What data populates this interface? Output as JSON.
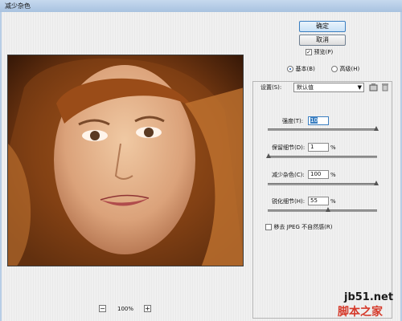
{
  "window": {
    "title": "减少杂色"
  },
  "buttons": {
    "ok": "确定",
    "cancel": "取消"
  },
  "preview_checkbox": {
    "label": "预览(P)",
    "checked": true
  },
  "mode": {
    "basic": "基本(B)",
    "advanced": "高级(H)",
    "selected": "basic"
  },
  "settings": {
    "label": "设置(S):",
    "value": "默认值"
  },
  "controls": [
    {
      "label": "强度(T):",
      "value": "10",
      "unit": "",
      "fraction": 0.99
    },
    {
      "label": "保留细节(D):",
      "value": "1",
      "unit": "%",
      "fraction": 0.01
    },
    {
      "label": "减少杂色(C):",
      "value": "100",
      "unit": "%",
      "fraction": 0.99
    },
    {
      "label": "锐化细节(H):",
      "value": "55",
      "unit": "%",
      "fraction": 0.55
    }
  ],
  "jpeg_option": {
    "label": "移去 JPEG 不自然感(R)",
    "checked": false
  },
  "zoom": {
    "minus": "−",
    "value": "100%",
    "plus": "+"
  },
  "watermark": {
    "site": "jb51.net",
    "brand": "脚本之家"
  },
  "icons": {
    "save": "save-settings-icon",
    "delete": "trash-icon"
  }
}
